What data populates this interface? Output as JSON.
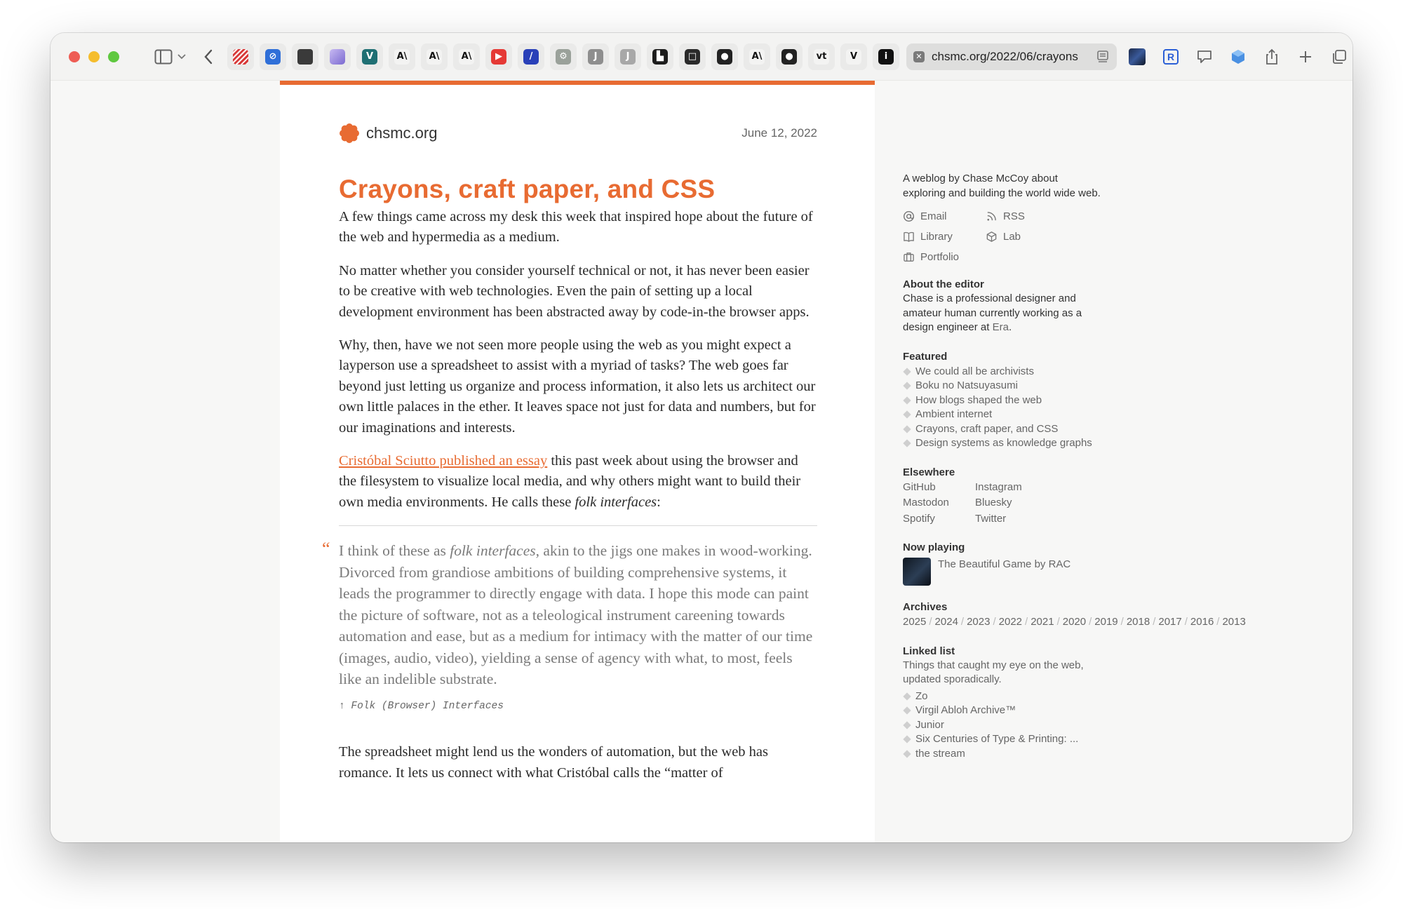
{
  "browser": {
    "url": "chsmc.org/2022/06/crayons",
    "favorites": [
      {
        "icon": "stripes-icon",
        "color": "#d83a3a",
        "glyph": ""
      },
      {
        "icon": "circle-slash-icon",
        "color": "#2f6fd8",
        "glyph": "⊘"
      },
      {
        "icon": "cube-icon",
        "color": "#3a3a3a",
        "glyph": ""
      },
      {
        "icon": "stack-icon",
        "color": "#8c7bd9",
        "glyph": ""
      },
      {
        "icon": "v-icon",
        "color": "#1f6f73",
        "glyph": "V"
      },
      {
        "icon": "anthropic-icon",
        "color": "#f3f3f2",
        "glyph": "A\\"
      },
      {
        "icon": "anthropic-icon",
        "color": "#f3f3f2",
        "glyph": "A\\"
      },
      {
        "icon": "anthropic-icon",
        "color": "#f3f3f2",
        "glyph": "A\\"
      },
      {
        "icon": "youtube-icon",
        "color": "#e53935",
        "glyph": "▶"
      },
      {
        "icon": "slash-icon",
        "color": "#2940b8",
        "glyph": "/"
      },
      {
        "icon": "gear-icon",
        "color": "#9aa19a",
        "glyph": "⚙"
      },
      {
        "icon": "j-icon",
        "color": "#8e8e8e",
        "glyph": "J"
      },
      {
        "icon": "j-icon",
        "color": "#a8a8a8",
        "glyph": "J"
      },
      {
        "icon": "frame-icon",
        "color": "#1c1c1c",
        "glyph": "▙"
      },
      {
        "icon": "frame-icon",
        "color": "#2a2a2a",
        "glyph": "□"
      },
      {
        "icon": "github-icon",
        "color": "#222222",
        "glyph": "●"
      },
      {
        "icon": "anthropic-icon",
        "color": "#f3f3f2",
        "glyph": "A\\"
      },
      {
        "icon": "github-icon",
        "color": "#222222",
        "glyph": "●"
      },
      {
        "icon": "vt-icon",
        "color": "#f3f3f2",
        "glyph": "vt"
      },
      {
        "icon": "v-icon",
        "color": "#f3f3f2",
        "glyph": "V"
      },
      {
        "icon": "info-icon",
        "color": "#111111",
        "glyph": "i"
      }
    ]
  },
  "article": {
    "site_name": "chsmc.org",
    "date": "June 12, 2022",
    "title": "Crayons, craft paper, and CSS",
    "p1": "A few things came across my desk this week that inspired hope about the future of the web and hypermedia as a medium.",
    "p2": "No matter whether you consider yourself technical or not, it has never been easier to be creative with web technologies. Even the pain of setting up a local development environment has been abstracted away by code-in-the browser apps.",
    "p3": "Why, then, have we not seen more people using the web as you might expect a layperson use a spreadsheet to assist with a myriad of tasks? The web goes far beyond just letting us organize and process information, it also lets us architect our own little palaces in the ether. It leaves space not just for data and numbers, but for our imaginations and interests.",
    "p4_link": "Cristóbal Sciutto published an essay",
    "p4_text1": " this past week about using the browser and the filesystem to visualize local media, and why others might want to build their own media environments. He calls these ",
    "p4_em": "folk interfaces",
    "p4_text2": ":",
    "quote_mark": "“",
    "quote_text1": "I think of these as ",
    "quote_em": "folk interfaces",
    "quote_text2": ", akin to the jigs one makes in wood-working. Divorced from grandiose ambitions of building comprehensive systems, it leads the programmer to directly engage with data. I hope this mode can paint the picture of software, not as a teleological instrument careening towards automation and ease, but as a medium for intimacy with the matter of our time (images, audio, video), yielding a sense of agency with what, to most, feels like an indelible substrate.",
    "quote_cite": "↑ Folk (Browser) Interfaces",
    "p5": "The spreadsheet might lend us the wonders of automation, but the web has romance. It lets us connect with what Cristóbal calls the “matter of"
  },
  "sidebar": {
    "tagline": "A weblog by Chase McCoy about exploring and building the world wide web.",
    "links": {
      "email": "Email",
      "rss": "RSS",
      "library": "Library",
      "lab": "Lab",
      "portfolio": "Portfolio"
    },
    "about_title": "About the editor",
    "about_text": "Chase is a professional designer and amateur human currently working as a design engineer at ",
    "about_era": "Era",
    "about_end": ".",
    "featured_title": "Featured",
    "featured": [
      "We could all be archivists",
      "Boku no Natsuyasumi",
      "How blogs shaped the web",
      "Ambient internet",
      "Crayons, craft paper, and CSS",
      "Design systems as knowledge graphs"
    ],
    "elsewhere_title": "Elsewhere",
    "elsewhere": [
      "GitHub",
      "Instagram",
      "Mastodon",
      "Bluesky",
      "Spotify",
      "Twitter"
    ],
    "now_playing_title": "Now playing",
    "now_playing": "The Beautiful Game by RAC",
    "archives_title": "Archives",
    "archives": [
      "2025",
      "2024",
      "2023",
      "2022",
      "2021",
      "2020",
      "2019",
      "2018",
      "2017",
      "2016",
      "2013"
    ],
    "linked_title": "Linked list",
    "linked_desc": "Things that caught my eye on the web, updated sporadically.",
    "linked": [
      "Zo",
      "Virgil Abloh Archive™",
      "Junior",
      "Six Centuries of Type & Printing: ...",
      "the stream"
    ]
  }
}
